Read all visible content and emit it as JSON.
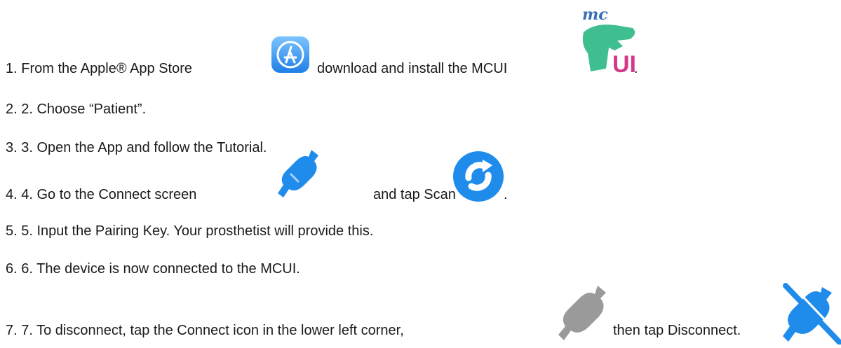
{
  "steps": [
    {
      "num": "1.",
      "parts": [
        "From the Apple® App Store",
        "download and install the MCUI",
        "."
      ]
    },
    {
      "num": "2.",
      "parts": [
        "2. Choose “Patient”."
      ]
    },
    {
      "num": "3.",
      "parts": [
        "3. Open the App and follow the Tutorial."
      ]
    },
    {
      "num": "4.",
      "parts": [
        "4. Go to the Connect screen",
        "and tap Scan",
        "."
      ]
    },
    {
      "num": "5.",
      "parts": [
        "5. Input the Pairing Key. Your prosthetist will provide this."
      ]
    },
    {
      "num": "6.",
      "parts": [
        "6. The device is now connected to the MCUI."
      ]
    },
    {
      "num": "7.",
      "parts": [
        "7. To disconnect, tap the Connect icon in the lower left corner,",
        "then tap Disconnect."
      ]
    }
  ],
  "logo": {
    "top": "mc",
    "bottom": "UI"
  },
  "icons": {
    "app_store": "app-store-icon",
    "mcui_logo": "mcui-logo-icon",
    "connect": "connect-plug-icon",
    "scan": "scan-refresh-icon",
    "connect_gray": "connect-plug-gray-icon",
    "disconnect": "disconnect-plug-icon"
  },
  "colors": {
    "app_store_blue": "#2f8ff0",
    "mcui_green": "#3fbf8f",
    "mcui_pink": "#d4388a",
    "connect_blue": "#1f8ceb",
    "connect_gray": "#9a9a9a"
  }
}
